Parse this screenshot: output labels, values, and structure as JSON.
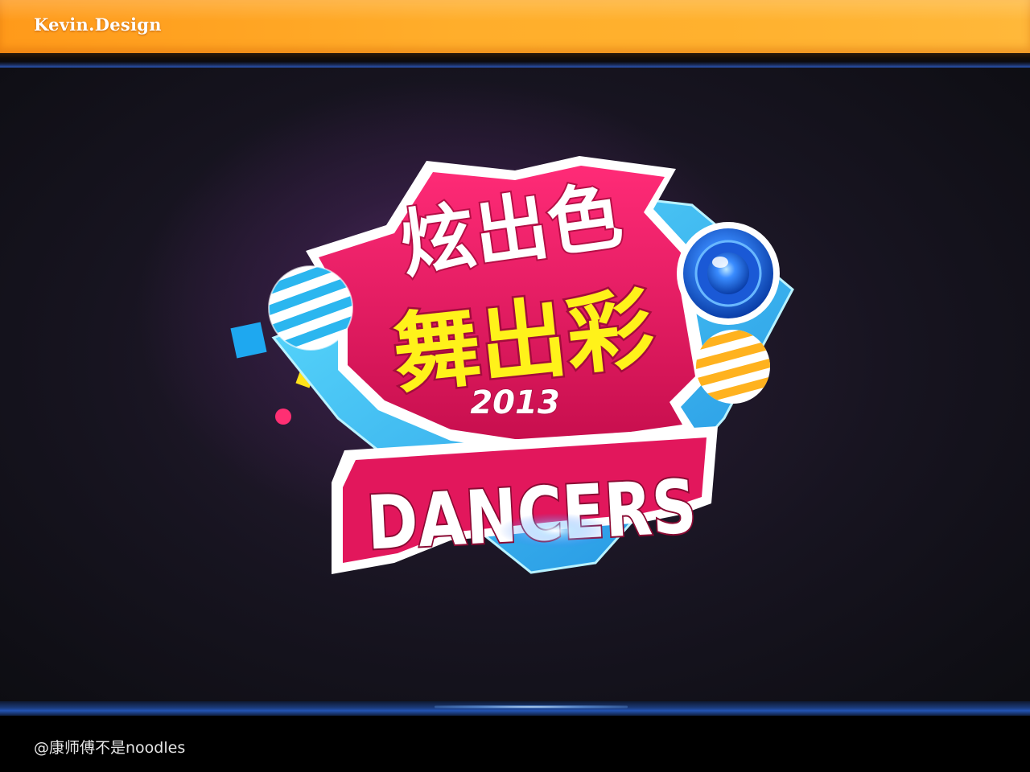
{
  "header": {
    "brand": "Kevin.Design"
  },
  "artwork": {
    "headline": "炫出色",
    "subline": "舞出彩",
    "year": "2013",
    "wordmark": "DANCERS"
  },
  "footer": {
    "credit": "@康师傅不是noodles"
  },
  "colors": {
    "header_orange": "#ffa523",
    "magenta": "#e2175c",
    "yellow": "#fff21a",
    "cyan": "#36c8f5",
    "blue": "#2a7bff",
    "orange_ball": "#ffb21e",
    "background": "#1b1622"
  },
  "icons": {
    "ball_left": "striped-ball-icon",
    "ball_right": "striped-ball-icon",
    "speaker": "speaker-icon"
  }
}
